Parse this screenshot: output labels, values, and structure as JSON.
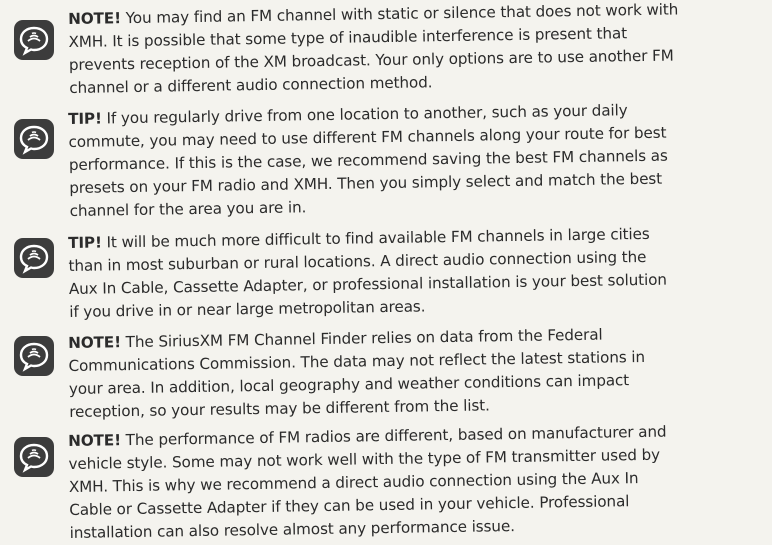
{
  "notes": [
    {
      "icon": "speech-bubble-icon",
      "label": "NOTE!",
      "lines": [
        " You may find an FM channel with static or silence that does not work with",
        "XMH. It is possible that some type of inaudible interference is present that",
        "prevents reception of the XM broadcast. Your only options are to use another FM",
        "channel or a different audio connection method."
      ]
    },
    {
      "icon": "speech-bubble-icon",
      "label": "TIP!",
      "lines": [
        " If you regularly drive from one location to another, such as your daily",
        "commute, you may need to use different FM channels along your route for best",
        "performance. If this is the case, we recommend saving the best FM channels as",
        "presets on your FM radio and XMH. Then you simply select and match the best",
        "channel for the area you are in."
      ]
    },
    {
      "icon": "speech-bubble-icon",
      "label": "TIP!",
      "lines": [
        " It will be much more difficult to find available FM channels in large cities",
        "than in most suburban or rural locations. A direct audio connection using the",
        "Aux In Cable, Cassette Adapter, or professional installation is your best solution",
        "if you drive in or near large metropolitan areas."
      ]
    },
    {
      "icon": "speech-bubble-icon",
      "label": "NOTE!",
      "lines": [
        " The SiriusXM FM Channel Finder relies on data from the Federal",
        "Communications Commission. The data may not reflect the latest stations in",
        "your area. In addition, local geography and weather conditions can impact",
        "reception, so your results may be different from the list."
      ]
    },
    {
      "icon": "speech-bubble-icon",
      "label": "NOTE!",
      "lines": [
        " The performance of FM radios are different, based on manufacturer and",
        "vehicle style. Some may not work well with the type of FM transmitter used by",
        "XMH. This is why we recommend a direct audio connection using the Aux In",
        "Cable or Cassette Adapter if they can be used in your vehicle. Professional",
        "installation can also resolve almost any performance issue."
      ]
    }
  ],
  "colors": {
    "text": "#2b2b2b",
    "icon_bg": "#3c3c3c",
    "icon_fg": "#ffffff",
    "paper": "#f4f3ee"
  }
}
